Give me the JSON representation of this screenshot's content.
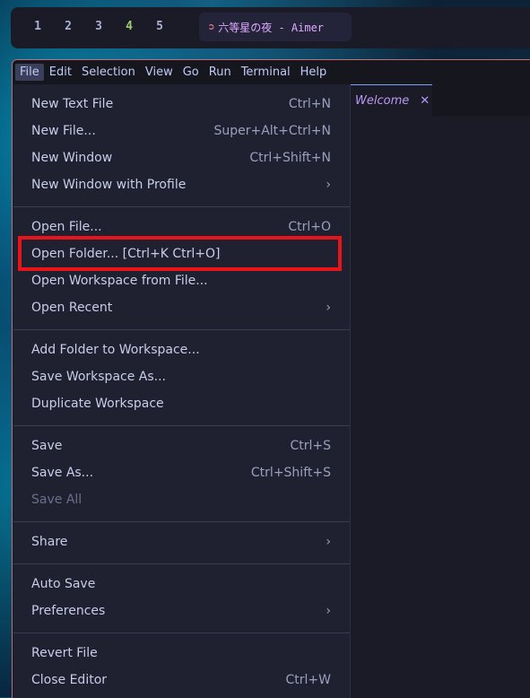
{
  "workspaces": [
    "1",
    "2",
    "3",
    "4",
    "5"
  ],
  "media": {
    "icon": "spotify-like-icon",
    "text": "六等星の夜 - Aimer"
  },
  "menubar": {
    "items": [
      "File",
      "Edit",
      "Selection",
      "View",
      "Go",
      "Run",
      "Terminal",
      "Help"
    ]
  },
  "tab": {
    "label": "Welcome",
    "close": "✕"
  },
  "file_menu": {
    "new_text_file": {
      "label": "New Text File",
      "key": "Ctrl+N"
    },
    "new_file": {
      "label": "New File...",
      "key": "Super+Alt+Ctrl+N"
    },
    "new_window": {
      "label": "New Window",
      "key": "Ctrl+Shift+N"
    },
    "new_window_profile": {
      "label": "New Window with Profile",
      "key": "›"
    },
    "open_file": {
      "label": "Open File...",
      "key": "Ctrl+O"
    },
    "open_folder": {
      "label": "Open Folder... [Ctrl+K Ctrl+O]"
    },
    "open_workspace_file": {
      "label": "Open Workspace from File..."
    },
    "open_recent": {
      "label": "Open Recent",
      "key": "›"
    },
    "add_folder_workspace": {
      "label": "Add Folder to Workspace..."
    },
    "save_workspace_as": {
      "label": "Save Workspace As..."
    },
    "duplicate_workspace": {
      "label": "Duplicate Workspace"
    },
    "save": {
      "label": "Save",
      "key": "Ctrl+S"
    },
    "save_as": {
      "label": "Save As...",
      "key": "Ctrl+Shift+S"
    },
    "save_all": {
      "label": "Save All"
    },
    "share": {
      "label": "Share",
      "key": "›"
    },
    "auto_save": {
      "label": "Auto Save"
    },
    "preferences": {
      "label": "Preferences",
      "key": "›"
    },
    "revert_file": {
      "label": "Revert File"
    },
    "close_editor": {
      "label": "Close Editor",
      "key": "Ctrl+W"
    }
  },
  "colors": {
    "highlight": "#e8141a",
    "active_workspace": "#9ece6a",
    "tab_text": "#bb9af7"
  }
}
